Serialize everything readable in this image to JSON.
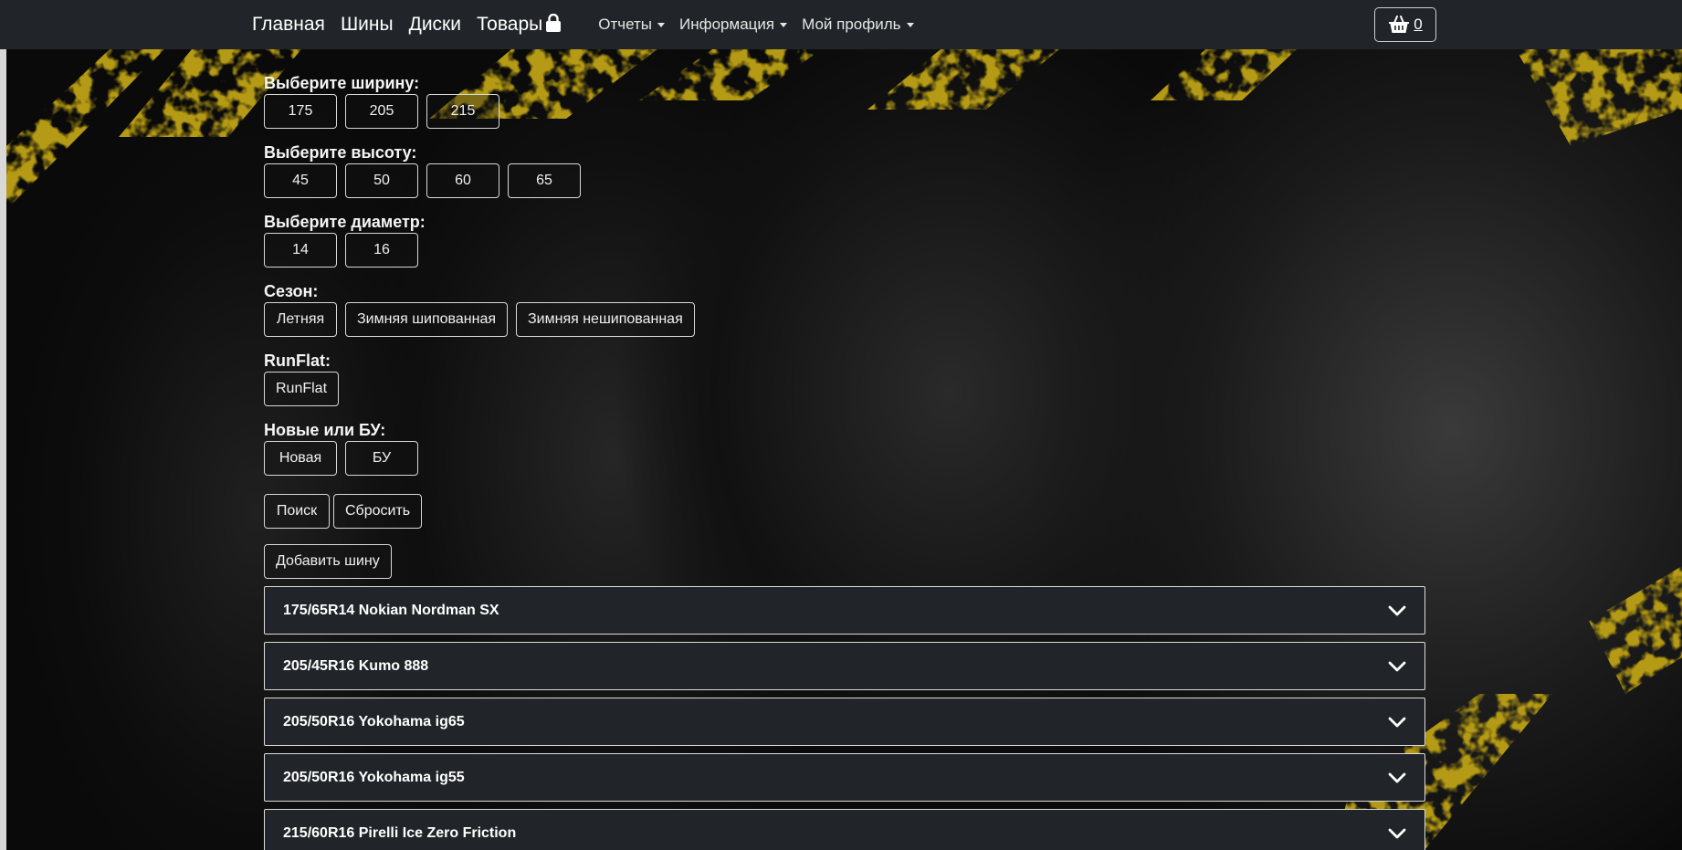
{
  "nav": {
    "links": [
      "Главная",
      "Шины",
      "Диски",
      "Товары"
    ],
    "dropdowns": [
      "Отчеты",
      "Информация",
      "Мой профиль"
    ],
    "cart_count": "0"
  },
  "filters": {
    "width": {
      "label": "Выберите ширину:",
      "options": [
        "175",
        "205",
        "215"
      ]
    },
    "height": {
      "label": "Выберите высоту:",
      "options": [
        "45",
        "50",
        "60",
        "65"
      ]
    },
    "diameter": {
      "label": "Выберите диаметр:",
      "options": [
        "14",
        "16"
      ]
    },
    "season": {
      "label": "Сезон:",
      "options": [
        "Летняя",
        "Зимняя шипованная",
        "Зимняя нешипованная"
      ]
    },
    "runflat": {
      "label": "RunFlat:",
      "options": [
        "RunFlat"
      ]
    },
    "condition": {
      "label": "Новые или БУ:",
      "options": [
        "Новая",
        "БУ"
      ]
    }
  },
  "actions": {
    "search": "Поиск",
    "reset": "Сбросить",
    "add": "Добавить шину"
  },
  "tires": [
    "175/65R14 Nokian Nordman SX",
    "205/45R16 Kumo 888",
    "205/50R16 Yokohama ig65",
    "205/50R16 Yokohama ig55",
    "215/60R16 Pirelli Ice Zero Friction"
  ],
  "colors": {
    "navbar": "#212529",
    "accent_stripe": "#b59a12",
    "text": "#ffffff"
  }
}
